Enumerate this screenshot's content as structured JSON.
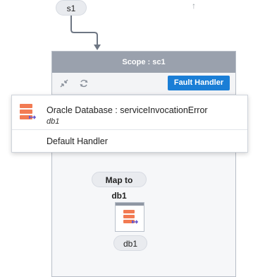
{
  "nodes": {
    "start": "s1",
    "map": "Map to db1",
    "db": "db1"
  },
  "scope": {
    "title": "Scope : sc1",
    "fault_handler_label": "Fault Handler"
  },
  "popup": {
    "items": [
      {
        "title": "Oracle Database : serviceInvocationError",
        "subtitle": "db1"
      },
      {
        "title": "Default Handler"
      }
    ]
  },
  "colors": {
    "accent": "#1a7ed6",
    "scope_header": "#9aa1ad",
    "db_icon": "#f27b53"
  },
  "icons": {
    "collapse": "collapse-arrows-icon",
    "refresh": "refresh-icon",
    "database": "database-icon",
    "up_arrow": "up-arrow-icon"
  }
}
